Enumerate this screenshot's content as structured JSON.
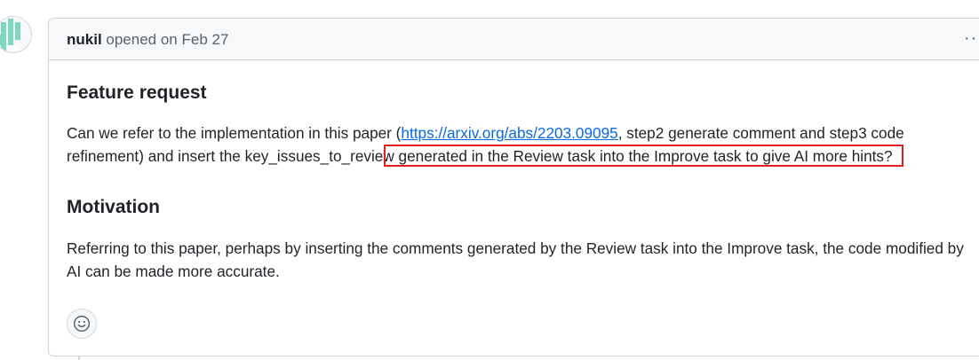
{
  "comment": {
    "author": "nukil",
    "opened_text": " opened on Feb 27",
    "more_label": "···"
  },
  "body": {
    "heading_feature": "Feature request",
    "feature_text_1": "Can we refer to the implementation in this paper (",
    "paper_link": "https://arxiv.org/abs/2203.09095",
    "feature_text_2": ", step2 generate comment and step3 code refinement) and insert the key_issues_to_review generated in the Review task into the Improve task to give AI more hints?",
    "heading_motivation": "Motivation",
    "motivation_text": "Referring to this paper, perhaps by inserting the comments generated by the Review task into the Improve task, the code modified by AI can be made more accurate."
  },
  "icons": {
    "avatar": "identicon-avatar",
    "more": "kebab-horizontal-icon",
    "reaction": "smiley-icon"
  },
  "colors": {
    "link": "#0969da",
    "highlight": "#e02020",
    "identicon": "#7fd6c1"
  }
}
